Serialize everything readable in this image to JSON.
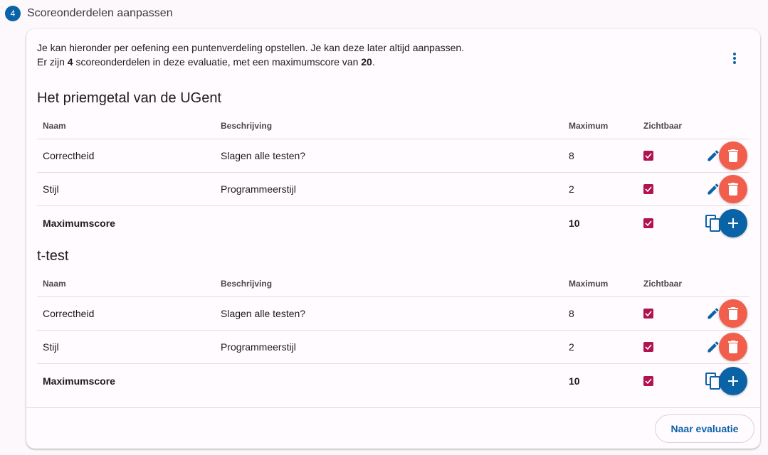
{
  "step": {
    "number": "4",
    "title": "Scoreonderdelen aanpassen"
  },
  "intro": {
    "line1": "Je kan hieronder per oefening een puntenverdeling opstellen. Je kan deze later altijd aanpassen.",
    "line2_prefix": "Er zijn ",
    "line2_count": "4",
    "line2_middle": " scoreonderdelen in deze evaluatie, met een maximumscore van ",
    "line2_max": "20",
    "line2_suffix": "."
  },
  "columns": {
    "name": "Naam",
    "description": "Beschrijving",
    "maximum": "Maximum",
    "visible": "Zichtbaar"
  },
  "exercises": [
    {
      "title": "Het priemgetal van de UGent",
      "rows": [
        {
          "name": "Correctheid",
          "description": "Slagen alle testen?",
          "maximum": "8",
          "visible": true
        },
        {
          "name": "Stijl",
          "description": "Programmeerstijl",
          "maximum": "2",
          "visible": true
        }
      ],
      "total": {
        "label": "Maximumscore",
        "maximum": "10",
        "visible": true
      }
    },
    {
      "title": "t-test",
      "rows": [
        {
          "name": "Correctheid",
          "description": "Slagen alle testen?",
          "maximum": "8",
          "visible": true
        },
        {
          "name": "Stijl",
          "description": "Programmeerstijl",
          "maximum": "2",
          "visible": true
        }
      ],
      "total": {
        "label": "Maximumscore",
        "maximum": "10",
        "visible": true
      }
    }
  ],
  "footer": {
    "button_label": "Naar evaluatie"
  },
  "icons": {
    "more": "more-vertical-icon",
    "edit": "pencil-icon",
    "delete": "trash-icon",
    "copy": "copy-icon",
    "add": "plus-icon",
    "check": "check-icon"
  },
  "colors": {
    "primary": "#0b63a7",
    "delete": "#f25e4c",
    "checkbox": "#b0134f",
    "background": "#fcf8fb"
  }
}
